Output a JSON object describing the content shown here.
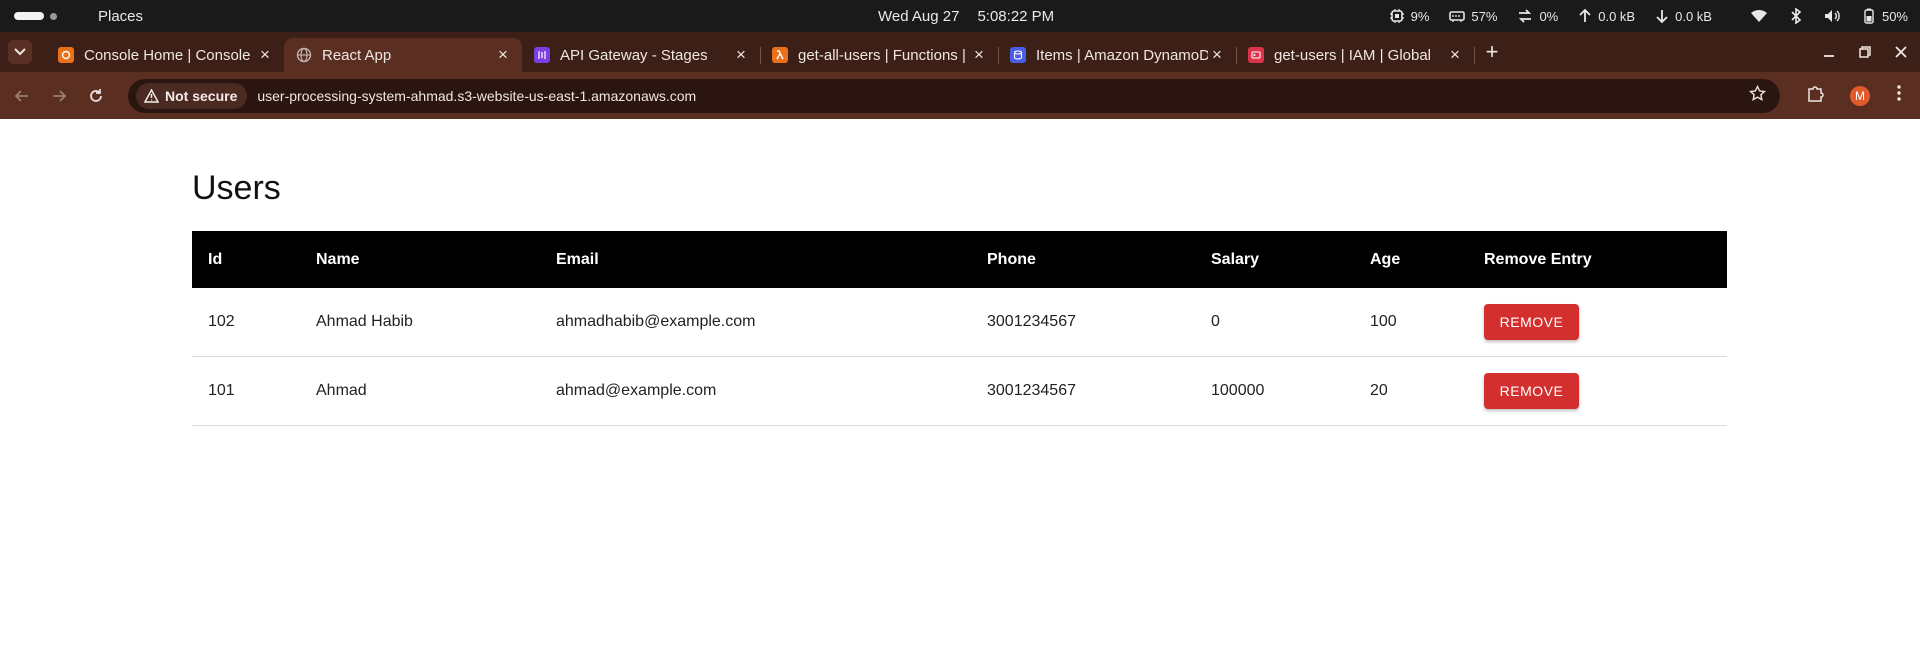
{
  "topbar": {
    "places": "Places",
    "date": "Wed Aug 27",
    "time": "5:08:22 PM",
    "cpu": "9%",
    "memory": "57%",
    "swap": "0%",
    "upload": "0.0 kB",
    "download": "0.0 kB",
    "battery": "50%"
  },
  "tabs": [
    {
      "title": "Console Home | Console",
      "favicon_color": "#e8711a",
      "icon": "aws-console-icon"
    },
    {
      "title": "React App",
      "favicon_color": "#8a8a8a",
      "icon": "globe-icon"
    },
    {
      "title": "API Gateway - Stages",
      "favicon_color": "#7b3fe4",
      "icon": "api-gateway-icon"
    },
    {
      "title": "get-all-users | Functions |",
      "favicon_color": "#e8711a",
      "icon": "lambda-icon"
    },
    {
      "title": "Items | Amazon DynamoDB",
      "favicon_color": "#4a5de8",
      "icon": "dynamodb-icon"
    },
    {
      "title": "get-users | IAM | Global",
      "favicon_color": "#dd344c",
      "icon": "iam-icon"
    }
  ],
  "addressbar": {
    "security_label": "Not secure",
    "url": "user-processing-system-ahmad.s3-website-us-east-1.amazonaws.com",
    "profile_initial": "M"
  },
  "page": {
    "title": "Users",
    "columns": [
      "Id",
      "Name",
      "Email",
      "Phone",
      "Salary",
      "Age",
      "Remove Entry"
    ],
    "rows": [
      {
        "id": "102",
        "name": "Ahmad Habib",
        "email": "ahmadhabib@example.com",
        "phone": "3001234567",
        "salary": "0",
        "age": "100",
        "action": "REMOVE"
      },
      {
        "id": "101",
        "name": "Ahmad",
        "email": "ahmad@example.com",
        "phone": "3001234567",
        "salary": "100000",
        "age": "20",
        "action": "REMOVE"
      }
    ],
    "remove_color": "#d32f2f"
  }
}
